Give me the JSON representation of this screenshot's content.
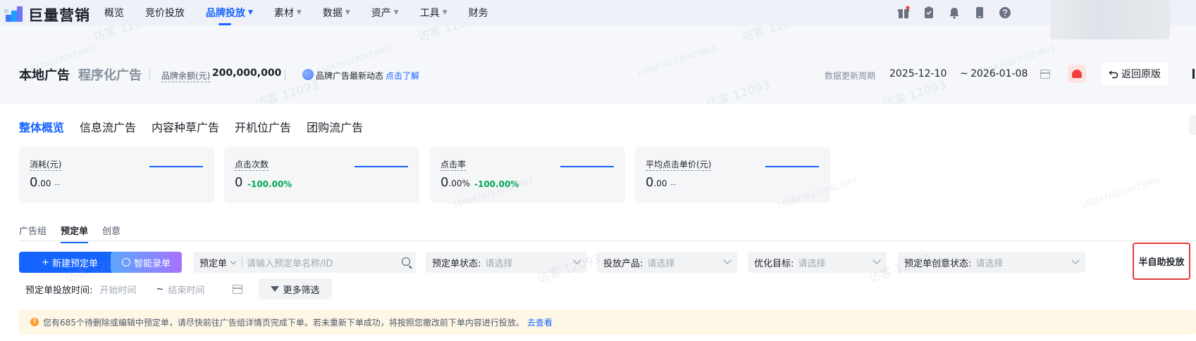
{
  "brand": {
    "logo_text": "巨量营销"
  },
  "nav": {
    "items": [
      {
        "label": "概览",
        "caret": false,
        "active": false
      },
      {
        "label": "竞价投放",
        "caret": false,
        "active": false
      },
      {
        "label": "品牌投放",
        "caret": true,
        "active": true
      },
      {
        "label": "素材",
        "caret": true,
        "active": false
      },
      {
        "label": "数据",
        "caret": true,
        "active": false
      },
      {
        "label": "资产",
        "caret": true,
        "active": false
      },
      {
        "label": "工具",
        "caret": true,
        "active": false
      },
      {
        "label": "财务",
        "caret": false,
        "active": false
      }
    ],
    "icons": [
      "gift-icon",
      "clipboard-icon",
      "bell-icon",
      "phone-icon",
      "help-icon"
    ]
  },
  "header": {
    "title": "本地广告",
    "title_secondary": "程序化广告",
    "balance_label": "品牌余额(元)",
    "balance_value": "200,000,000",
    "news_text": "品牌广告最新动态",
    "news_link": "点击了解",
    "update_label": "数据更新周期",
    "date_start": "2025-12-10",
    "date_sep": "~",
    "date_end": "2026-01-08",
    "back_label": "返回原版"
  },
  "tabs": [
    "整体概览",
    "信息流广告",
    "内容种草广告",
    "开机位广告",
    "团购流广告"
  ],
  "metrics": [
    {
      "label": "消耗(元)",
      "value_main": "0",
      "value_dec": ".00",
      "delta": "--",
      "delta_type": "gray"
    },
    {
      "label": "点击次数",
      "value_main": "0",
      "value_dec": "",
      "delta": "-100.00%",
      "delta_type": "green"
    },
    {
      "label": "点击率",
      "value_main": "0",
      "value_dec": ".00%",
      "delta": "-100.00%",
      "delta_type": "green"
    },
    {
      "label": "平均点击单价(元)",
      "value_main": "0",
      "value_dec": ".00",
      "delta": "--",
      "delta_type": "gray"
    }
  ],
  "subtabs": [
    "广告组",
    "预定单",
    "创意"
  ],
  "actions": {
    "new_label": "新建预定单",
    "ai_label": "智能录单",
    "more_filter_label": "更多筛选",
    "semi_auto_label": "半自助投放"
  },
  "filters": {
    "search_type": "预定单",
    "search_placeholder": "请输入预定单名称/ID",
    "status_label": "预定单状态:",
    "product_label": "投放产品:",
    "goal_label": "优化目标:",
    "creative_status_label": "预定单创意状态:",
    "select_placeholder": "请选择",
    "time_label": "预定单投放时间:",
    "time_start_placeholder": "开始时间",
    "time_sep": "~",
    "time_end_placeholder": "结束时间"
  },
  "notice": {
    "text": "您有685个待删除或编辑中预定单，请尽快前往广告组详情页完成下单。若未重新下单成功，将按照您撤改前下单内容进行投放。",
    "link": "去查看"
  },
  "watermark": {
    "visitor": "访客 12093",
    "id": "16884762220923803"
  },
  "colors": {
    "accent": "#1664ff",
    "success": "#00a854",
    "warning": "#ff9a2e",
    "highlight": "#e43b3b"
  }
}
